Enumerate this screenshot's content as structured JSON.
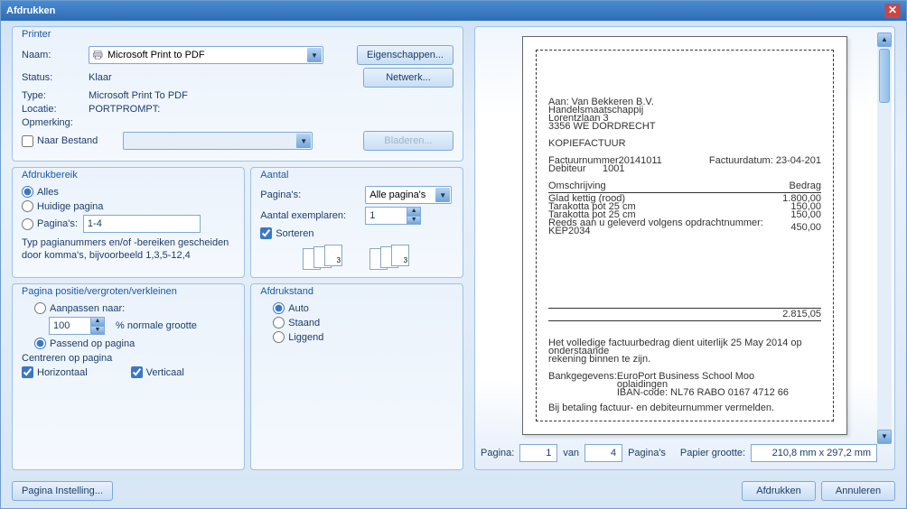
{
  "window": {
    "title": "Afdrukken"
  },
  "printer": {
    "group_title": "Printer",
    "name_label": "Naam:",
    "name_value": "Microsoft Print to PDF",
    "status_label": "Status:",
    "status_value": "Klaar",
    "type_label": "Type:",
    "type_value": "Microsoft Print To PDF",
    "location_label": "Locatie:",
    "location_value": "PORTPROMPT:",
    "comment_label": "Opmerking:",
    "properties_btn": "Eigenschappen...",
    "network_btn": "Netwerk...",
    "to_file_label": "Naar Bestand",
    "browse_btn": "Bladeren..."
  },
  "range": {
    "group_title": "Afdrukbereik",
    "all": "Alles",
    "current": "Huidige pagina",
    "pages_label": "Pagina's:",
    "pages_value": "1-4",
    "hint": "Typ pagianummers en/of -bereiken gescheiden door komma's, bijvoorbeeld 1,3,5-12,4"
  },
  "copies": {
    "group_title": "Aantal",
    "pages_label": "Pagina's:",
    "pages_value": "Alle pagina's",
    "copies_label": "Aantal exemplaren:",
    "copies_value": "1",
    "collate_label": "Sorteren"
  },
  "position": {
    "group_title": "Pagina positie/vergroten/verkleinen",
    "adjust_label": "Aanpassen naar:",
    "percent_value": "100",
    "percent_label": "% normale grootte",
    "fit_label": "Passend op pagina",
    "center_label": "Centreren op pagina",
    "horizontal": "Horizontaal",
    "vertical": "Verticaal"
  },
  "orientation": {
    "group_title": "Afdrukstand",
    "auto": "Auto",
    "portrait": "Staand",
    "landscape": "Liggend"
  },
  "status": {
    "page_label": "Pagina:",
    "page_value": "1",
    "of_label": "van",
    "total_value": "4",
    "pages_word": "Pagina's",
    "paper_label": "Papier grootte:",
    "paper_value": "210,8 mm x 297,2 mm"
  },
  "footer": {
    "page_setup": "Pagina Instelling...",
    "print": "Afdrukken",
    "cancel": "Annuleren"
  },
  "preview_doc": {
    "addr1": "Aan: Van Bekkeren B.V.",
    "addr2": "Handelsmaatschappij",
    "addr3": "Lorentzlaan 3",
    "addr4": "3356 WE  DORDRECHT",
    "doctype": "KOPIEFACTUUR",
    "factnr_lbl": "Factuurnummer20141011",
    "factdat_lbl": "Factuurdatum: 23-04-201",
    "debnr_lbl": "Debiteur",
    "debnr_val": "1001",
    "col1": "Omschrijving",
    "col2": "Bedrag",
    "line1a": "Glad kettig (rood)",
    "line1b": "1.800,00",
    "line2a": "Tarakotta pot 25 cm",
    "line2b": "150,00",
    "line3a": "Tarakotta pot 25 cm",
    "line3b": "150,00",
    "line4a": "Reeds aan u geleverd volgens opdrachtnummer: KEP2034",
    "line4b": "450,00",
    "total": "2.815,05",
    "foot1": "Het volledige factuurbedrag dient uiterlijk 25 May 2014 op onderstaande",
    "foot2": "rekening binnen te zijn.",
    "bank1": "Bankgegevens:",
    "bank2": "EuroPort Business School Moo",
    "bank3": "oplaidingen",
    "bank4": "IBAN-code: NL76 RABO 0167 4712 66",
    "foot3": "Bij betaling factuur- en debiteurnummer vermelden."
  }
}
